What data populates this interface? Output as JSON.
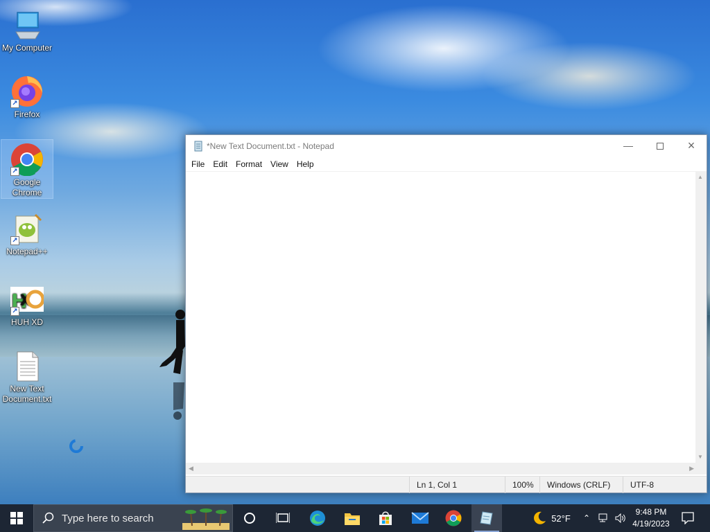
{
  "desktop": {
    "icons": [
      {
        "label": "My Computer"
      },
      {
        "label": "Firefox"
      },
      {
        "label": "Google Chrome"
      },
      {
        "label": "Notepad++"
      },
      {
        "label": "HUH XD"
      },
      {
        "label": "New Text Document.txt"
      }
    ]
  },
  "notepad": {
    "title": "*New Text Document.txt - Notepad",
    "menu": [
      "File",
      "Edit",
      "Format",
      "View",
      "Help"
    ],
    "content": "",
    "status": {
      "position": "Ln 1, Col 1",
      "zoom": "100%",
      "line_ending": "Windows (CRLF)",
      "encoding": "UTF-8"
    }
  },
  "taskbar": {
    "search_placeholder": "Type here to search",
    "weather": "52°F",
    "time": "9:48 PM",
    "date": "4/19/2023"
  }
}
